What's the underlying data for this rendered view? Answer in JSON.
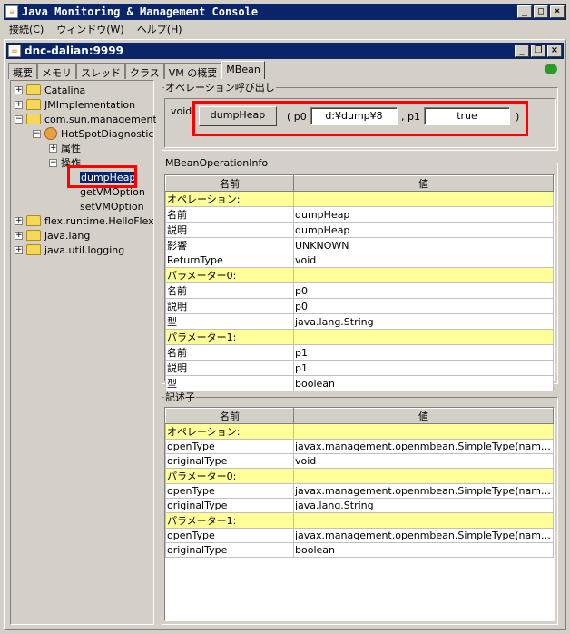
{
  "window": {
    "title": "Java Monitoring & Management Console"
  },
  "menu": [
    "接続(C)",
    "ウィンドウ(W)",
    "ヘルプ(H)"
  ],
  "connection": {
    "title": "dnc-dalian:9999"
  },
  "tabs": [
    "概要",
    "メモリ",
    "スレッド",
    "クラス",
    "VM の概要",
    "MBean"
  ],
  "tree": {
    "items": [
      "Catalina",
      "JMImplementation",
      "com.sun.management",
      "HotSpotDiagnostic",
      "属性",
      "操作",
      "dumpHeap",
      "getVMOption",
      "setVMOption",
      "flex.runtime.HelloFlex",
      "java.lang",
      "java.util.logging"
    ]
  },
  "invoke": {
    "legend": "オペレーション呼び出し",
    "return_type": "void",
    "button": "dumpHeap",
    "open": "( p0",
    "p0_value": "d:¥dump¥8",
    "sep": ", p1",
    "p1_value": "true",
    "close": ")"
  },
  "info": {
    "legend": "MBeanOperationInfo",
    "headers": [
      "名前",
      "値"
    ],
    "rows": [
      [
        "オペレーション:",
        ""
      ],
      [
        "名前",
        "dumpHeap"
      ],
      [
        "説明",
        "dumpHeap"
      ],
      [
        "影響",
        "UNKNOWN"
      ],
      [
        "ReturnType",
        "void"
      ],
      [
        "パラメーター0:",
        ""
      ],
      [
        "名前",
        "p0"
      ],
      [
        "説明",
        "p0"
      ],
      [
        "型",
        "java.lang.String"
      ],
      [
        "パラメーター1:",
        ""
      ],
      [
        "名前",
        "p1"
      ],
      [
        "説明",
        "p1"
      ],
      [
        "型",
        "boolean"
      ]
    ]
  },
  "descriptor": {
    "legend": "記述子",
    "headers": [
      "名前",
      "値"
    ],
    "rows": [
      [
        "オペレーション:",
        ""
      ],
      [
        "openType",
        "javax.management.openmbean.SimpleType(name=java.lang.Void)"
      ],
      [
        "originalType",
        "void"
      ],
      [
        "パラメーター0:",
        ""
      ],
      [
        "openType",
        "javax.management.openmbean.SimpleType(name=java.lang.String)"
      ],
      [
        "originalType",
        "java.lang.String"
      ],
      [
        "パラメーター1:",
        ""
      ],
      [
        "openType",
        "javax.management.openmbean.SimpleType(name=java.lang.Boolean)"
      ],
      [
        "originalType",
        "boolean"
      ]
    ]
  }
}
